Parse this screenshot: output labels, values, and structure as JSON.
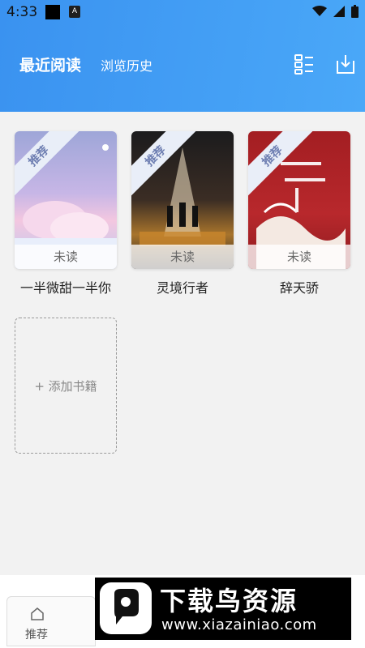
{
  "status": {
    "time": "4:33",
    "app_badge": "A"
  },
  "header": {
    "title": "最近阅读",
    "subtitle": "浏览历史"
  },
  "books": [
    {
      "title": "一半微甜一半你",
      "badge": "推荐",
      "status": "未读"
    },
    {
      "title": "灵境行者",
      "badge": "推荐",
      "status": "未读"
    },
    {
      "title": "辞天骄",
      "badge": "推荐",
      "status": "未读"
    }
  ],
  "add_book_label": "+ 添加书籍",
  "bottom_nav": {
    "home_label": "推荐"
  },
  "watermark": {
    "title": "下载鸟资源",
    "url": "www.xiazainiao.com"
  },
  "colors": {
    "header": "#3a92f0",
    "background": "#f2f2f2"
  }
}
